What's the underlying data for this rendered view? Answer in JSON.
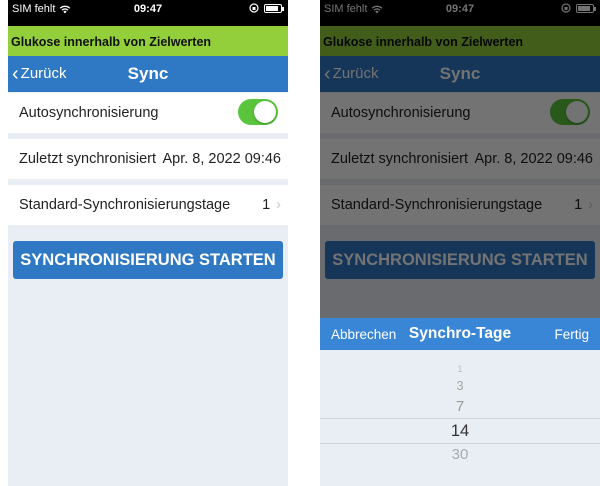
{
  "status_bar": {
    "carrier": "SIM fehlt",
    "time": "09:47"
  },
  "banner": {
    "text": "Glukose innerhalb von Zielwerten",
    "color": "#93cf3b"
  },
  "navbar": {
    "back_label": "Zurück",
    "title": "Sync",
    "color": "#2f78c4"
  },
  "settings": {
    "auto_sync_label": "Autosynchronisierung",
    "auto_sync_on": true,
    "last_sync_label": "Zuletzt synchronisiert",
    "last_sync_value": "Apr. 8, 2022 09:46",
    "default_days_label": "Standard-Synchronisierungstage",
    "default_days_value": "1"
  },
  "sync_button_label": "SYNCHRONISIERUNG STARTEN",
  "picker": {
    "cancel_label": "Abbrechen",
    "title": "Synchro-Tage",
    "done_label": "Fertig",
    "options": [
      "1",
      "3",
      "7",
      "14",
      "30"
    ],
    "selected": "14"
  }
}
